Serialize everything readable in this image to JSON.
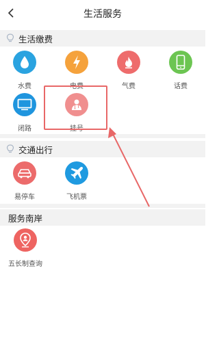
{
  "header": {
    "title": "生活服务"
  },
  "sections": {
    "life": {
      "title": "生活缴费"
    },
    "transport": {
      "title": "交通出行"
    },
    "south": {
      "title": "服务南岸"
    }
  },
  "items": {
    "water": {
      "label": "水费",
      "color": "#2aa3e0",
      "icon": "water-drop-icon"
    },
    "electricity": {
      "label": "电费",
      "color": "#f5a23c",
      "icon": "lightning-icon"
    },
    "gas": {
      "label": "气费",
      "color": "#ee6c6c",
      "icon": "flame-icon"
    },
    "phone": {
      "label": "话费",
      "color": "#6cc552",
      "icon": "mobile-phone-icon"
    },
    "tv": {
      "label": "闭路",
      "color": "#1f95de",
      "icon": "tv-icon"
    },
    "register": {
      "label": "挂号",
      "color": "#f08f8f",
      "icon": "doctor-icon"
    },
    "parking": {
      "label": "易停车",
      "color": "#ec6b6b",
      "icon": "car-icon"
    },
    "flight": {
      "label": "飞机票",
      "color": "#1f9ae0",
      "icon": "airplane-icon"
    },
    "river": {
      "label": "五长制查询",
      "color": "#ee6461",
      "icon": "location-person-icon"
    }
  },
  "colors": {
    "section_bg": "#f2f2f2",
    "highlight": "#e86767"
  }
}
